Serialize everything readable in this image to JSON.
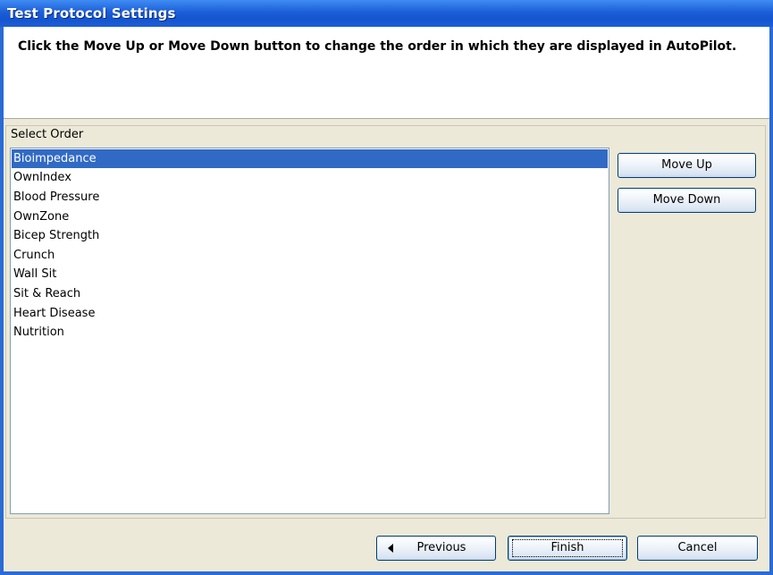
{
  "window": {
    "title": "Test Protocol Settings"
  },
  "header": {
    "instruction": "Click the Move Up or Move Down button to change the order in which they are displayed in AutoPilot."
  },
  "order_group": {
    "label": "Select Order",
    "items": [
      {
        "label": "Bioimpedance",
        "selected": true
      },
      {
        "label": "OwnIndex",
        "selected": false
      },
      {
        "label": "Blood Pressure",
        "selected": false
      },
      {
        "label": "OwnZone",
        "selected": false
      },
      {
        "label": "Bicep Strength",
        "selected": false
      },
      {
        "label": "Crunch",
        "selected": false
      },
      {
        "label": "Wall Sit",
        "selected": false
      },
      {
        "label": "Sit & Reach",
        "selected": false
      },
      {
        "label": "Heart Disease",
        "selected": false
      },
      {
        "label": "Nutrition",
        "selected": false
      }
    ],
    "move_up_label": "Move Up",
    "move_down_label": "Move Down"
  },
  "footer": {
    "previous_label": "Previous",
    "previous_icon": "left-arrow-icon",
    "finish_label": "Finish",
    "cancel_label": "Cancel"
  },
  "colors": {
    "titlebar": "#1c5fd8",
    "selection": "#316ac5",
    "dialog_bg": "#ece9d8"
  }
}
